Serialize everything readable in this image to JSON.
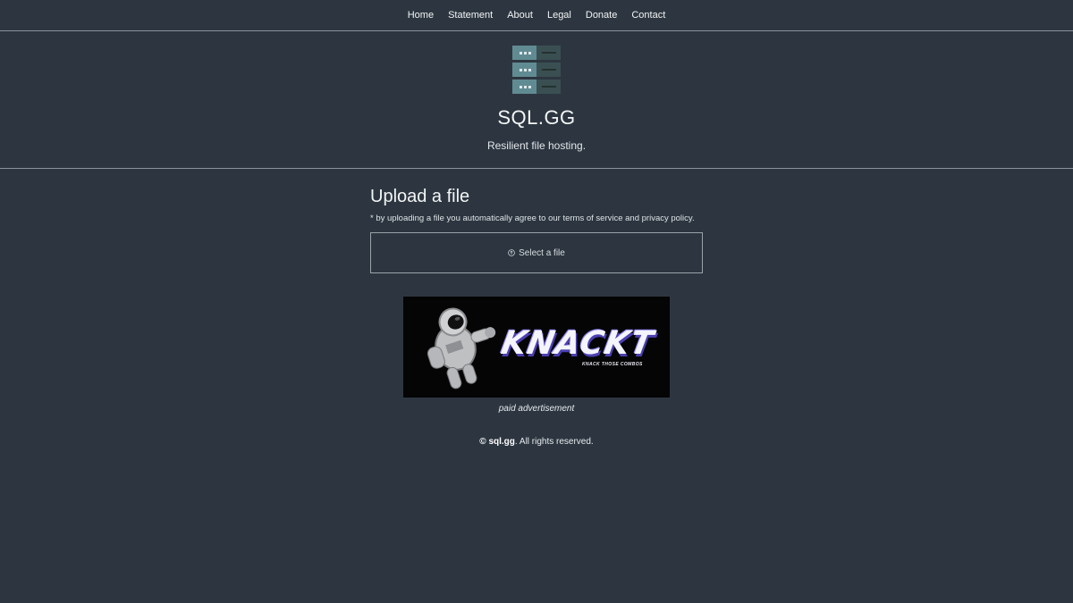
{
  "nav": {
    "items": [
      {
        "label": "Home"
      },
      {
        "label": "Statement"
      },
      {
        "label": "About"
      },
      {
        "label": "Legal"
      },
      {
        "label": "Donate"
      },
      {
        "label": "Contact"
      }
    ]
  },
  "header": {
    "title": "SQL.GG",
    "tagline": "Resilient file hosting.",
    "logo_icon": "server-rack-icon"
  },
  "upload": {
    "title": "Upload a file",
    "terms_note": "* by uploading a file you automatically agree to our terms of service and privacy policy.",
    "select_label": "Select a file",
    "select_icon": "upload-circle-icon"
  },
  "ad": {
    "brand": "KNACKT",
    "subtitle": "KNACK THOSE COMBOS",
    "caption": "paid advertisement"
  },
  "footer": {
    "brand": "© sql.gg",
    "rights": ". All rights reserved."
  },
  "colors": {
    "background": "#2d3640",
    "text": "#e8ecef",
    "divider": "#8a939b",
    "logo_teal": "#6b9aa2",
    "logo_dark": "#3a4f52"
  }
}
